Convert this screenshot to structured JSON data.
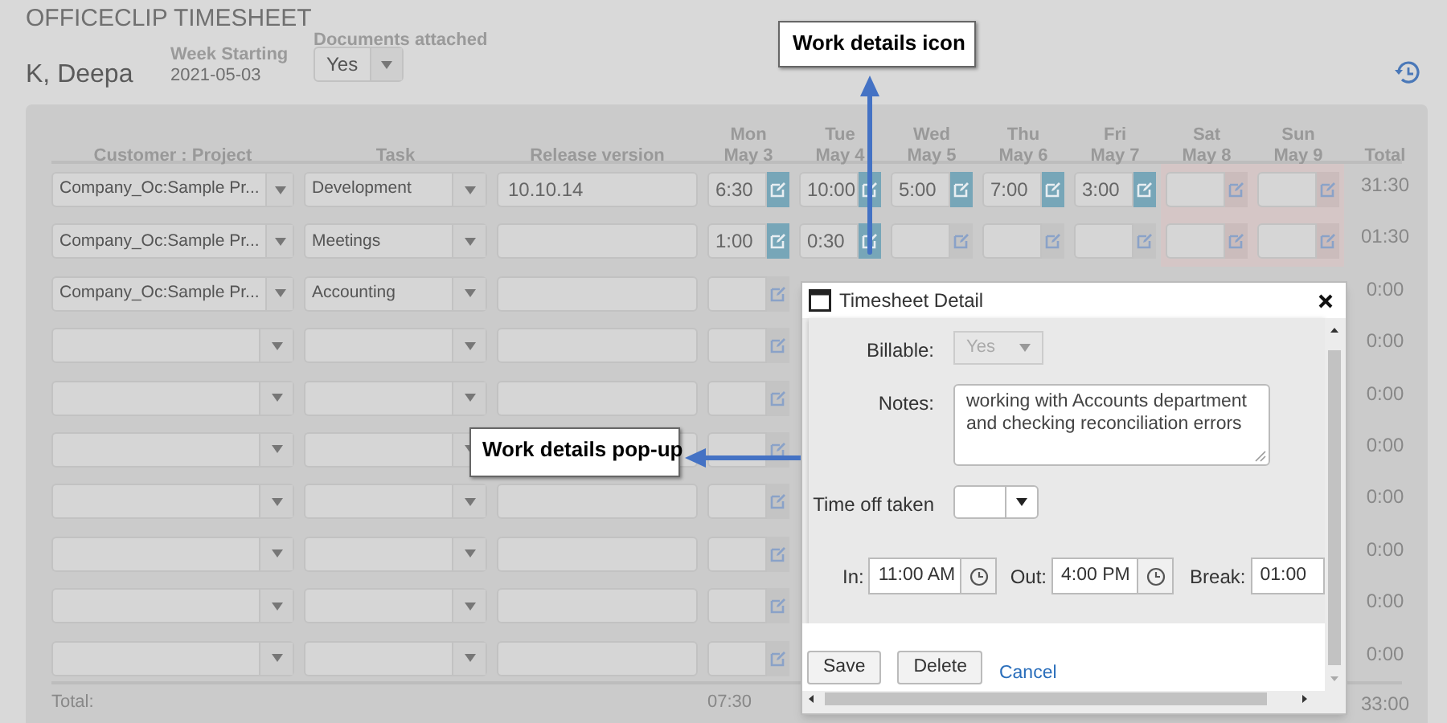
{
  "app_title": "OFFICECLIP TIMESHEET",
  "employee": "K, Deepa",
  "week_starting": {
    "label": "Week Starting",
    "value": "2021-05-03"
  },
  "documents_attached": {
    "label": "Documents attached",
    "value": "Yes"
  },
  "table": {
    "columns": [
      "Customer : Project",
      "Task",
      "Release version"
    ],
    "day_columns": [
      {
        "day": "Mon",
        "date": "May 3",
        "weekend": false
      },
      {
        "day": "Tue",
        "date": "May 4",
        "weekend": false
      },
      {
        "day": "Wed",
        "date": "May 5",
        "weekend": false
      },
      {
        "day": "Thu",
        "date": "May 6",
        "weekend": false
      },
      {
        "day": "Fri",
        "date": "May 7",
        "weekend": false
      },
      {
        "day": "Sat",
        "date": "May 8",
        "weekend": true
      },
      {
        "day": "Sun",
        "date": "May 9",
        "weekend": true
      }
    ],
    "total_column": "Total",
    "rows": [
      {
        "customer_project": "Company_Oc:Sample Pr...",
        "task": "Development",
        "release_version": "10.10.14",
        "days": [
          {
            "value": "6:30",
            "has_details": true
          },
          {
            "value": "10:00",
            "has_details": true
          },
          {
            "value": "5:00",
            "has_details": true
          },
          {
            "value": "7:00",
            "has_details": true
          },
          {
            "value": "3:00",
            "has_details": true
          },
          {
            "has_details": false
          },
          {
            "has_details": false
          }
        ],
        "total": "31:30"
      },
      {
        "customer_project": "Company_Oc:Sample Pr...",
        "task": "Meetings",
        "days": [
          {
            "value": "1:00",
            "has_details": true
          },
          {
            "value": "0:30",
            "has_details": true
          },
          {
            "has_details": false
          },
          {
            "has_details": false
          },
          {
            "has_details": false
          },
          {
            "has_details": false
          },
          {
            "has_details": false
          }
        ],
        "total": "01:30"
      },
      {
        "customer_project": "Company_Oc:Sample Pr...",
        "task": "Accounting",
        "days": [
          {
            "has_details": false
          }
        ],
        "total": "0:00"
      },
      {
        "days": [
          {
            "has_details": false
          }
        ],
        "total": "0:00"
      },
      {
        "days": [
          {
            "has_details": false
          }
        ],
        "total": "0:00"
      },
      {
        "days": [
          {
            "has_details": false
          }
        ],
        "total": "0:00"
      },
      {
        "days": [
          {
            "has_details": false
          }
        ],
        "total": "0:00"
      },
      {
        "days": [
          {
            "has_details": false
          }
        ],
        "total": "0:00"
      },
      {
        "days": [
          {
            "has_details": false
          }
        ],
        "total": "0:00"
      },
      {
        "days": [
          {
            "has_details": false
          }
        ],
        "total": "0:00"
      }
    ],
    "footer": {
      "label": "Total:",
      "day_totals": [
        "07:30"
      ],
      "grand_total": "33:00"
    }
  },
  "dialog": {
    "title": "Timesheet Detail",
    "billable": {
      "label": "Billable:",
      "value": "Yes",
      "disabled": true
    },
    "notes": {
      "label": "Notes:",
      "value": "working with Accounts department\nand checking reconciliation errors"
    },
    "time_off": {
      "label": "Time off taken"
    },
    "time_in": {
      "label": "In:",
      "value": "11:00 AM"
    },
    "time_out": {
      "label": "Out:",
      "value": "4:00 PM"
    },
    "break": {
      "label": "Break:",
      "value": "01:00"
    },
    "buttons": [
      "Save",
      "Delete"
    ],
    "cancel": "Cancel"
  },
  "annotations": [
    {
      "kind": "up",
      "text": "Work details icon"
    },
    {
      "kind": "left",
      "text": "Work details pop-up"
    }
  ]
}
